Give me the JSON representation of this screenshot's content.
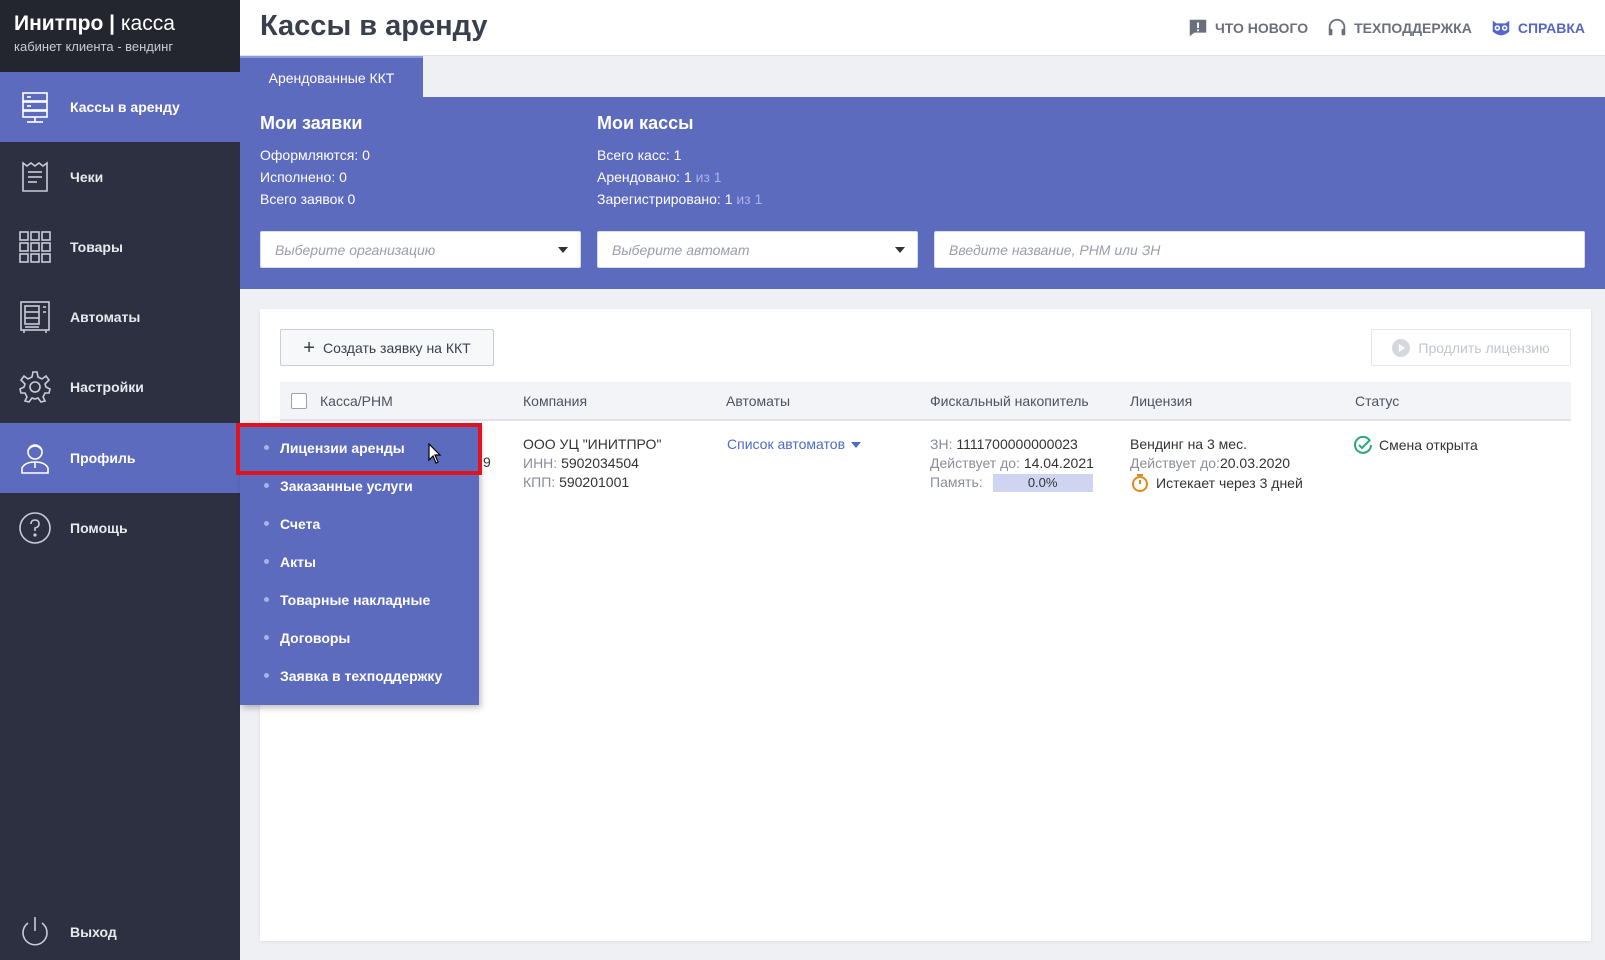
{
  "brand": {
    "title_bold": "Инитпро",
    "separator": "|",
    "title_light": "касса",
    "subtitle": "кабинет клиента - вендинг"
  },
  "sidebar": {
    "items": [
      {
        "label": "Кассы в аренду",
        "icon": "server-icon",
        "active": true
      },
      {
        "label": "Чеки",
        "icon": "receipt-icon",
        "active": false
      },
      {
        "label": "Товары",
        "icon": "grid-icon",
        "active": false
      },
      {
        "label": "Автоматы",
        "icon": "vending-machine-icon",
        "active": false
      },
      {
        "label": "Настройки",
        "icon": "gear-icon",
        "active": false
      },
      {
        "label": "Профиль",
        "icon": "user-icon",
        "active": true
      },
      {
        "label": "Помощь",
        "icon": "help-icon",
        "active": false
      }
    ],
    "logout": {
      "label": "Выход",
      "icon": "power-icon"
    }
  },
  "topbar": {
    "title": "Кассы в аренду",
    "links": [
      {
        "label": "ЧТО НОВОГО",
        "icon": "message-alert-icon"
      },
      {
        "label": "ТЕХПОДДЕРЖКА",
        "icon": "headset-icon"
      },
      {
        "label": "СПРАВКА",
        "icon": "owl-icon"
      }
    ]
  },
  "tab": {
    "label": "Арендованные ККТ"
  },
  "requests": {
    "title": "Мои заявки",
    "lines": [
      {
        "label": "Оформляются:",
        "value": "0"
      },
      {
        "label": "Исполнено:",
        "value": "0"
      },
      {
        "label": "Всего заявок",
        "value": "0"
      }
    ]
  },
  "kassas": {
    "title": "Мои кассы",
    "lines": [
      {
        "label": "Всего касс:",
        "value": "1",
        "suffix": ""
      },
      {
        "label": "Арендовано:",
        "value": "1",
        "suffix": "из 1"
      },
      {
        "label": "Зарегистрировано:",
        "value": "1",
        "suffix": "из 1"
      }
    ]
  },
  "filters": {
    "org_placeholder": "Выберите организацию",
    "machine_placeholder": "Выберите автомат",
    "search_placeholder": "Введите название, РНМ или ЗН"
  },
  "toolbar": {
    "create_label": "Создать заявку на ККТ",
    "extend_label": "Продлить лицензию"
  },
  "table": {
    "headers": [
      "Касса/РНМ",
      "Компания",
      "Автоматы",
      "Фискальный накопитель",
      "Лицензия",
      "Статус"
    ],
    "row": {
      "company_name": "ООО УЦ \"ИНИТПРО\"",
      "inn_label": "ИНН:",
      "inn": "5902034504",
      "kpp_label": "КПП:",
      "kpp": "590201001",
      "machines_link": "Список автоматов",
      "fn_label": "ЗН:",
      "fn": "1111700000000023",
      "fn_valid_label": "Действует до:",
      "fn_valid": "14.04.2021",
      "memory_label": "Память:",
      "memory": "0.0%",
      "license_name": "Вендинг на 3 мес.",
      "license_valid_label": "Действует до:",
      "license_valid": "20.03.2020",
      "license_expires": "Истекает через 3 дней",
      "status": "Смена открыта",
      "partial_digit": "9"
    }
  },
  "profile_menu": {
    "items": [
      "Лицензии аренды",
      "Заказанные услуги",
      "Счета",
      "Акты",
      "Товарные накладные",
      "Договоры",
      "Заявка в техподдержку"
    ]
  },
  "colors": {
    "accent": "#5d6bbf",
    "sidebar": "#2d3040",
    "highlight": "#e0141e",
    "status_ok": "#2aa876",
    "timer": "#e08a1e"
  }
}
